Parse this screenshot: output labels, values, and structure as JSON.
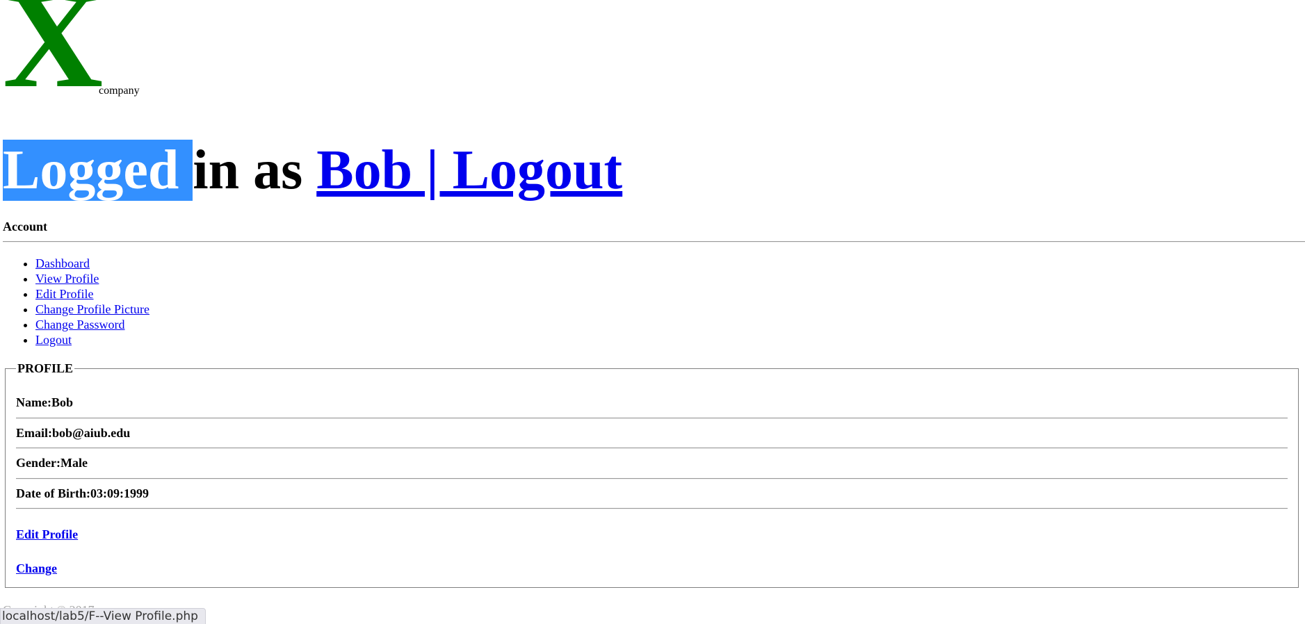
{
  "logo": {
    "letter": "X",
    "suffix": "company",
    "color": "#008000"
  },
  "header": {
    "logged_selected": "Logged ",
    "in_as": "in as ",
    "user_link": "Bob | Logout"
  },
  "account": {
    "label": "Account"
  },
  "nav": {
    "items": [
      {
        "label": "Dashboard"
      },
      {
        "label": "View Profile"
      },
      {
        "label": "Edit Profile"
      },
      {
        "label": "Change Profile Picture"
      },
      {
        "label": "Change Password"
      },
      {
        "label": "Logout"
      }
    ]
  },
  "profile": {
    "legend": "PROFILE",
    "name": "Name:Bob",
    "email": "Email:bob@aiub.edu",
    "gender": "Gender:Male",
    "dob": "Date of Birth:03:09:1999",
    "edit_link": "Edit Profile",
    "change_link": "Change"
  },
  "footer": {
    "copyright": "Copyright © 2017"
  },
  "status": {
    "url": "localhost/lab5/F--View Profile.php"
  },
  "colors": {
    "link": "#0000ee",
    "selection": "#3390ff",
    "logo": "#008000"
  }
}
